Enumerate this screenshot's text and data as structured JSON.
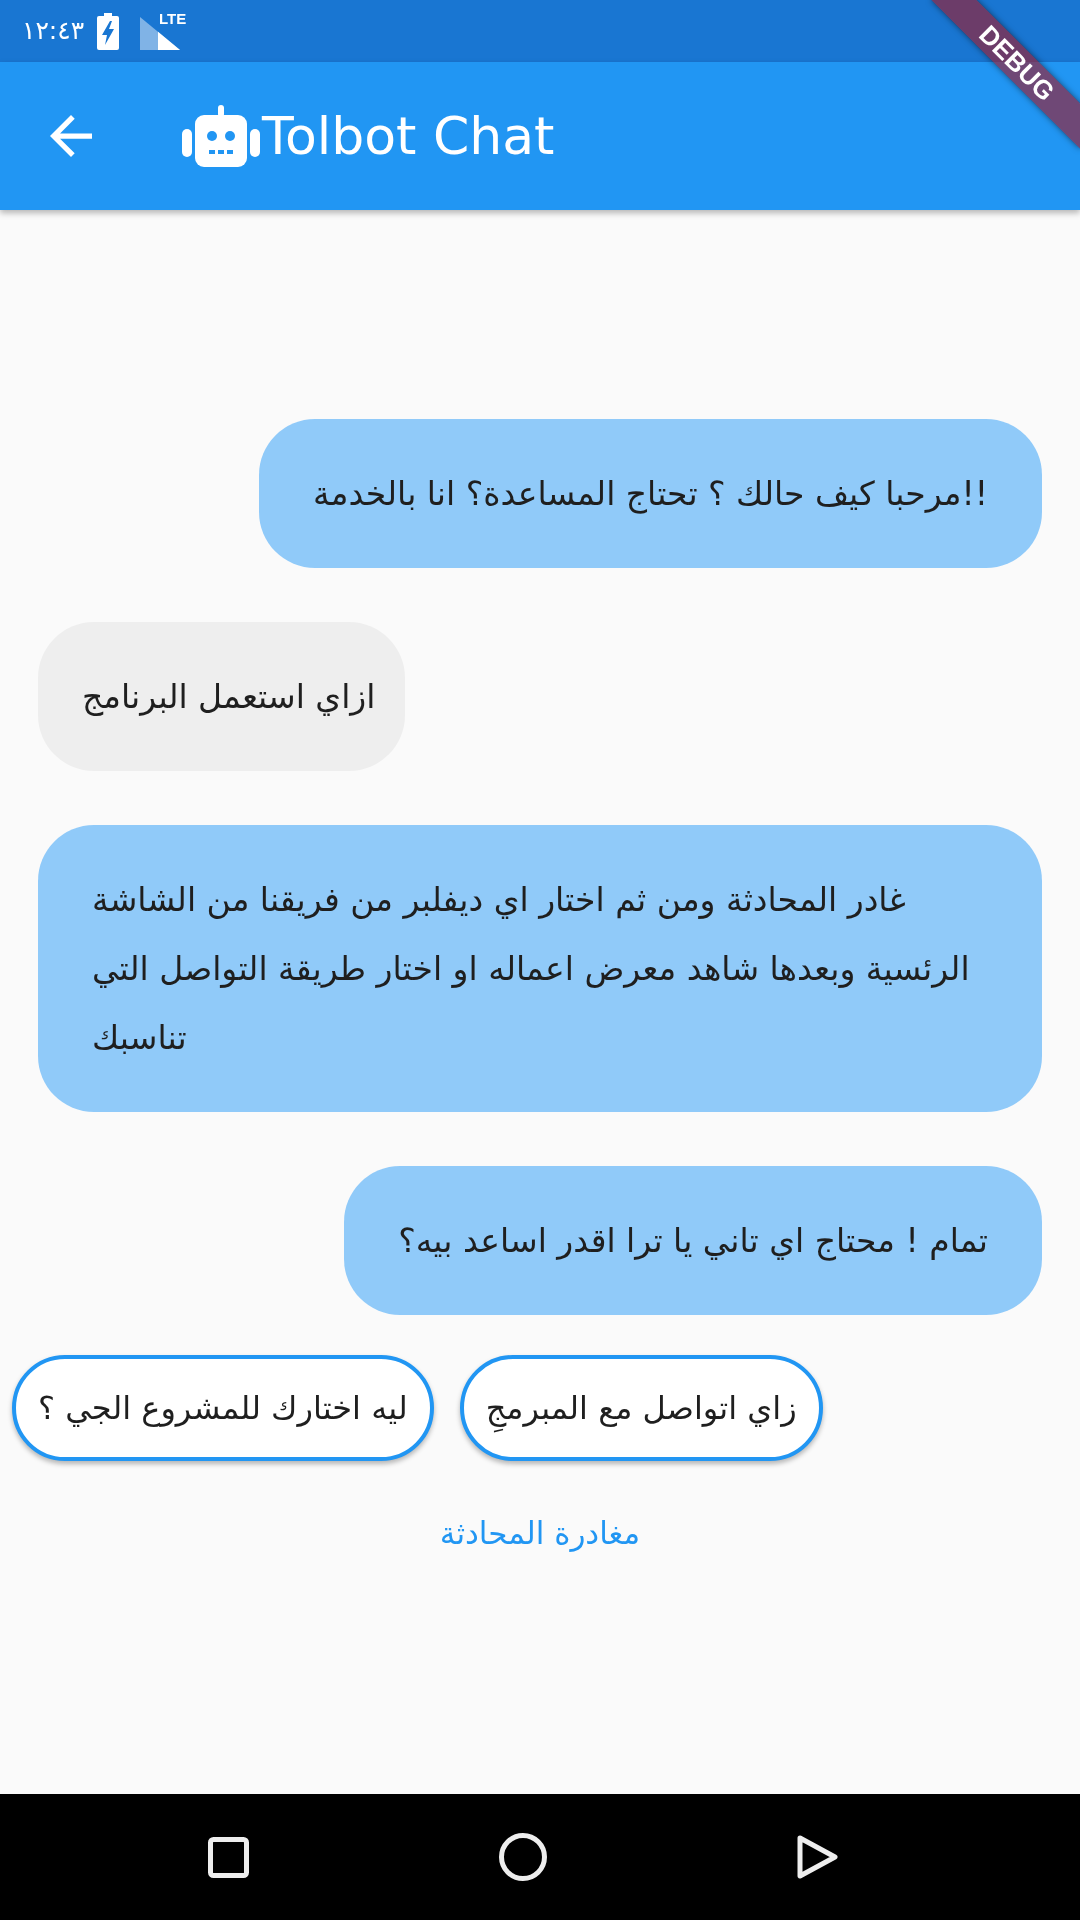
{
  "status_bar": {
    "time": "١٢:٤٣",
    "network_label": "LTE"
  },
  "debug_banner": "DEBUG",
  "app_bar": {
    "title": "Tolbot Chat"
  },
  "messages": [
    {
      "kind": "bot",
      "text": "مرحبا كيف حالك ؟ تحتاج المساعدة؟ انا بالخدمة!!"
    },
    {
      "kind": "user",
      "text": "ازاي استعمل البرنامج"
    },
    {
      "kind": "bot",
      "text": "غادر المحادثة ومن ثم اختار اي ديفلبر من فريقنا من الشاشة الرئسية وبعدها شاهد معرض اعماله او اختار طريقة التواصل التي تناسبك"
    },
    {
      "kind": "bot",
      "text": "تمام ! محتاج اي تاني يا ترا اقدر اساعد بيه؟"
    }
  ],
  "suggestions": [
    "زاي اتواصل مع المبرمجِ",
    "ليه اختارك للمشروع الجي ؟"
  ],
  "leave_link": "مغادرة المحادثة"
}
